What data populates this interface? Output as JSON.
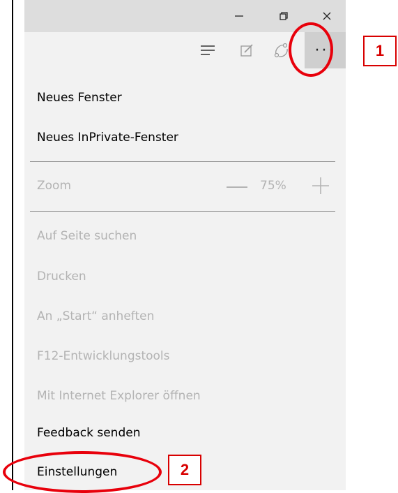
{
  "window": {
    "minimize_icon": "minimize-icon",
    "restore_icon": "restore-icon",
    "close_icon": "close-icon"
  },
  "toolbar": {
    "hub_icon": "hub-icon",
    "note_icon": "web-note-icon",
    "share_icon": "share-icon",
    "more_label": "···"
  },
  "menu": {
    "new_window": "Neues Fenster",
    "new_inprivate": "Neues InPrivate-Fenster",
    "zoom_label": "Zoom",
    "zoom_value": "75%",
    "find_on_page": "Auf Seite suchen",
    "print": "Drucken",
    "pin_start": "An „Start“ anheften",
    "f12_tools": "F12-Entwicklungstools",
    "open_ie": "Mit Internet Explorer öffnen",
    "feedback": "Feedback senden",
    "settings": "Einstellungen"
  },
  "annotations": {
    "callout_1": "1",
    "callout_2": "2",
    "color": "#d80000"
  }
}
